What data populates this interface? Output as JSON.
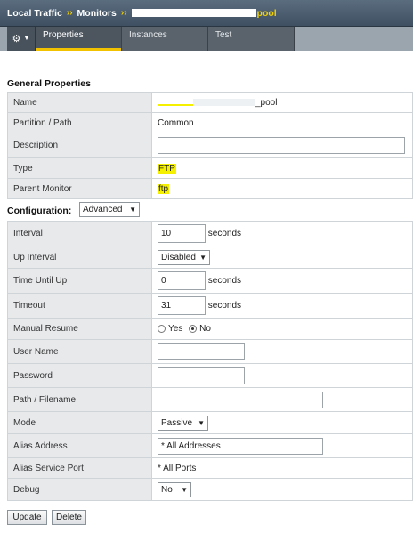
{
  "breadcrumb": {
    "items": [
      "Local Traffic",
      "Monitors"
    ],
    "separator": "››",
    "current": "pool"
  },
  "tabs": [
    {
      "label": "Properties",
      "active": true
    },
    {
      "label": "Instances",
      "active": false
    },
    {
      "label": "Test",
      "active": false
    }
  ],
  "general": {
    "title": "General Properties",
    "name_label": "Name",
    "name_value": "_pool",
    "partition_label": "Partition / Path",
    "partition_value": "Common",
    "description_label": "Description",
    "description_value": "",
    "type_label": "Type",
    "type_value": "FTP",
    "parent_label": "Parent Monitor",
    "parent_value": "ftp"
  },
  "config": {
    "title": "Configuration:",
    "mode_select": "Advanced",
    "interval_label": "Interval",
    "interval_value": "10",
    "interval_unit": "seconds",
    "up_interval_label": "Up Interval",
    "up_interval_value": "Disabled",
    "time_until_up_label": "Time Until Up",
    "time_until_up_value": "0",
    "time_until_up_unit": "seconds",
    "timeout_label": "Timeout",
    "timeout_value": "31",
    "timeout_unit": "seconds",
    "manual_resume_label": "Manual Resume",
    "manual_resume_yes": "Yes",
    "manual_resume_no": "No",
    "manual_resume_selected": "No",
    "username_label": "User Name",
    "username_value": "",
    "password_label": "Password",
    "password_value": "",
    "path_label": "Path / Filename",
    "path_value": "",
    "mode_label": "Mode",
    "mode_value": "Passive",
    "alias_address_label": "Alias Address",
    "alias_address_value": "* All Addresses",
    "alias_port_label": "Alias Service Port",
    "alias_port_value": "* All Ports",
    "debug_label": "Debug",
    "debug_value": "No"
  },
  "buttons": {
    "update": "Update",
    "delete": "Delete"
  },
  "colors": {
    "highlight": "#f5f000",
    "tab_accent": "#f2c200",
    "label_bg": "#e7e9eb"
  },
  "icons": {
    "gear": "gear-icon",
    "dropdown": "chevron-down-icon"
  }
}
